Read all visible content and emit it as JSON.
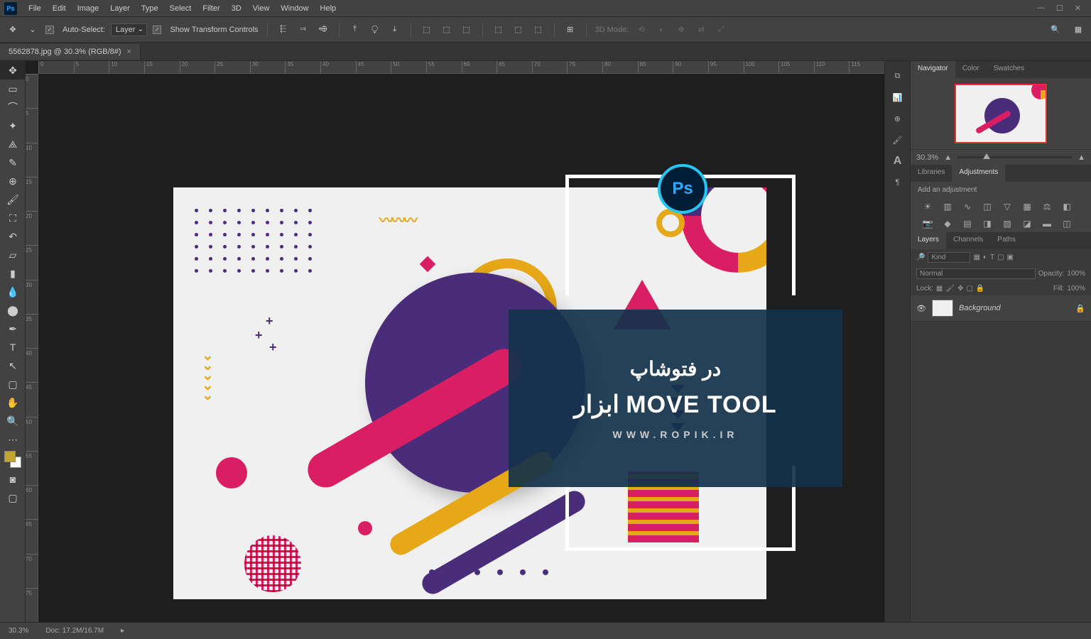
{
  "app": {
    "logo": "Ps"
  },
  "menu": [
    "File",
    "Edit",
    "Image",
    "Layer",
    "Type",
    "Select",
    "Filter",
    "3D",
    "View",
    "Window",
    "Help"
  ],
  "options": {
    "auto_select": "Auto-Select:",
    "auto_select_target": "Layer",
    "show_transform": "Show Transform Controls",
    "mode_3d": "3D Mode:"
  },
  "document": {
    "tab": "5562878.jpg @ 30.3% (RGB/8#)"
  },
  "rulers_h": [
    "0",
    "5",
    "10",
    "15",
    "20",
    "25",
    "30",
    "35",
    "40",
    "45",
    "50",
    "55",
    "60",
    "65",
    "70",
    "75",
    "80",
    "85",
    "90",
    "95",
    "100",
    "105",
    "110",
    "115"
  ],
  "rulers_v": [
    "0",
    "5",
    "10",
    "15",
    "20",
    "25",
    "30",
    "35",
    "40",
    "45",
    "50",
    "55",
    "60",
    "65",
    "70",
    "75"
  ],
  "overlay": {
    "line1": "در فتوشاپ",
    "line2": "ابزار MOVE TOOL",
    "url": "WWW.ROPIK.IR",
    "badge": "Ps"
  },
  "nav": {
    "tabs": [
      "Navigator",
      "Color",
      "Swatches"
    ],
    "zoom": "30.3%"
  },
  "adjustments": {
    "tabs": [
      "Libraries",
      "Adjustments"
    ],
    "label": "Add an adjustment"
  },
  "layers": {
    "tabs": [
      "Layers",
      "Channels",
      "Paths"
    ],
    "kind": "Kind",
    "blend": "Normal",
    "opacity_label": "Opacity:",
    "opacity_val": "100%",
    "lock_label": "Lock:",
    "fill_label": "Fill:",
    "fill_val": "100%",
    "item": "Background"
  },
  "status": {
    "zoom": "30.3%",
    "doc": "Doc: 17.2M/16.7M"
  }
}
